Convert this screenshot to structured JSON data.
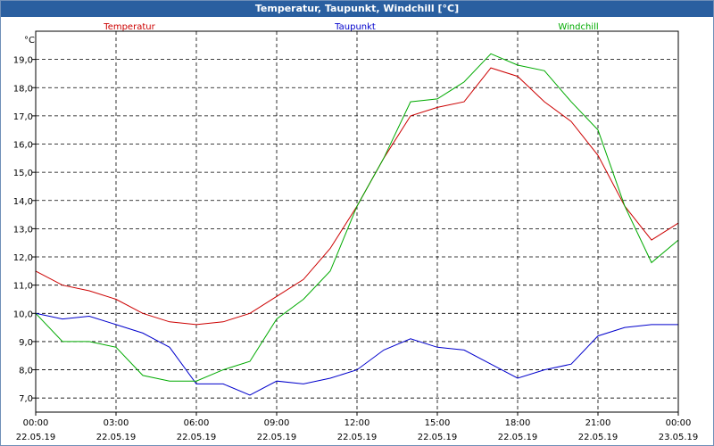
{
  "window": {
    "title": "Temperatur, Taupunkt, Windchill [°C]"
  },
  "chart_data": {
    "type": "line",
    "title": "Temperatur, Taupunkt, Windchill [°C]",
    "ylabel": "°C",
    "ylim": [
      6.5,
      20.0
    ],
    "y_ticks": [
      "7,0",
      "8,0",
      "9,0",
      "10,0",
      "11,0",
      "12,0",
      "13,0",
      "14,0",
      "15,0",
      "16,0",
      "17,0",
      "18,0",
      "19,0"
    ],
    "x_tick_times": [
      "00:00",
      "03:00",
      "06:00",
      "09:00",
      "12:00",
      "15:00",
      "18:00",
      "21:00",
      "00:00"
    ],
    "x_tick_dates": [
      "22.05.19",
      "22.05.19",
      "22.05.19",
      "22.05.19",
      "22.05.19",
      "22.05.19",
      "22.05.19",
      "22.05.19",
      "23.05.19"
    ],
    "grid": true,
    "legend_placement": "top",
    "x_hours": [
      0,
      1,
      2,
      3,
      4,
      5,
      6,
      7,
      8,
      9,
      10,
      11,
      12,
      13,
      14,
      15,
      16,
      17,
      18,
      19,
      20,
      21,
      22,
      23,
      24
    ],
    "series": [
      {
        "name": "Temperatur",
        "color": "#cc0000",
        "values": [
          11.5,
          11.0,
          10.8,
          10.5,
          10.0,
          9.7,
          9.6,
          9.7,
          10.0,
          10.6,
          11.2,
          12.3,
          13.8,
          15.5,
          17.0,
          17.3,
          17.5,
          18.7,
          18.4,
          17.5,
          16.8,
          15.6,
          13.8,
          12.6,
          13.2
        ]
      },
      {
        "name": "Taupunkt",
        "color": "#0000cc",
        "values": [
          10.0,
          9.8,
          9.9,
          9.6,
          9.3,
          8.8,
          7.5,
          7.5,
          7.1,
          7.6,
          7.5,
          7.7,
          8.0,
          8.7,
          9.1,
          8.8,
          8.7,
          8.2,
          7.7,
          8.0,
          8.2,
          9.2,
          9.5,
          9.6,
          9.6
        ]
      },
      {
        "name": "Windchill",
        "color": "#00aa00",
        "values": [
          10.0,
          9.0,
          9.0,
          8.8,
          7.8,
          7.6,
          7.6,
          8.0,
          8.3,
          9.8,
          10.5,
          11.5,
          13.8,
          15.5,
          17.5,
          17.6,
          18.2,
          19.2,
          18.8,
          18.6,
          17.5,
          16.5,
          13.8,
          11.8,
          12.6
        ]
      }
    ]
  }
}
